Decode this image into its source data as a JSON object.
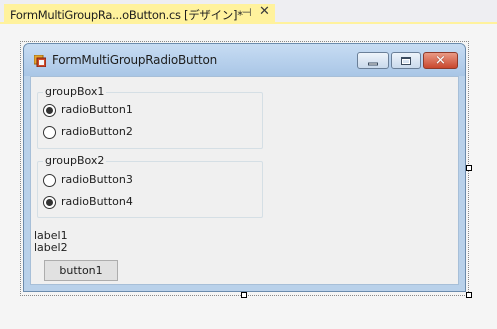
{
  "document_tab": {
    "title": "FormMultiGroupRa...oButton.cs [デザイン]*",
    "pin_glyph": "⊣",
    "close_glyph": "✕",
    "active_color": "#fff29d"
  },
  "form": {
    "title": "FormMultiGroupRadioButton",
    "minimize_icon": "minimize-icon",
    "maximize_icon": "maximize-icon",
    "close_glyph": "✕"
  },
  "group1": {
    "label": "groupBox1",
    "radios": [
      {
        "label": "radioButton1",
        "checked": true
      },
      {
        "label": "radioButton2",
        "checked": false
      }
    ]
  },
  "group2": {
    "label": "groupBox2",
    "radios": [
      {
        "label": "radioButton3",
        "checked": false
      },
      {
        "label": "radioButton4",
        "checked": true
      }
    ]
  },
  "labels": {
    "label1": "label1",
    "label2": "label2"
  },
  "button1": "button1"
}
